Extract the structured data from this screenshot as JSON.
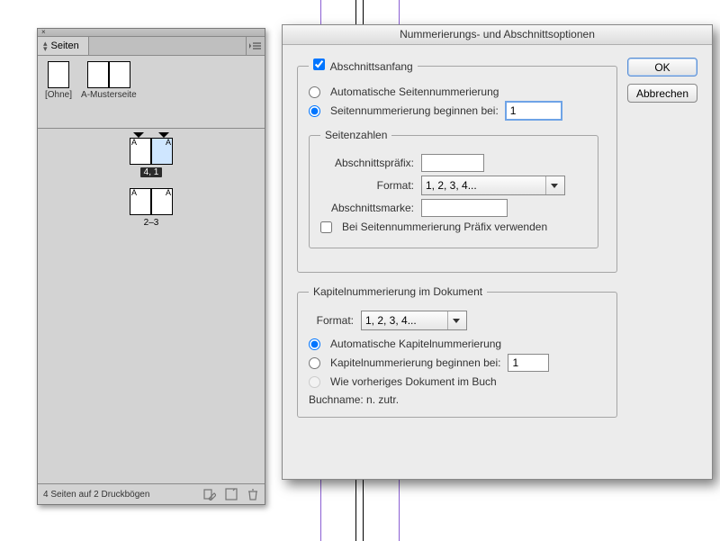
{
  "pagesPanel": {
    "tabLabel": "Seiten",
    "masters": [
      {
        "label": "[Ohne]"
      },
      {
        "label": "A-Musterseite"
      }
    ],
    "spreads": [
      {
        "label": "4, 1",
        "selected": true
      },
      {
        "label": "2–3",
        "selected": false
      }
    ],
    "footer": "4 Seiten auf 2 Druckbögen"
  },
  "dialog": {
    "title": "Nummerierungs- und Abschnittsoptionen",
    "ok": "OK",
    "cancel": "Abbrechen",
    "sectionStart": {
      "legend": "Abschnittsanfang",
      "auto": "Automatische Seitennummerierung",
      "startAt": "Seitennummerierung beginnen bei:",
      "startAtValue": "1"
    },
    "pageNumbers": {
      "legend": "Seitenzahlen",
      "prefixLabel": "Abschnittspräfix:",
      "prefixValue": "",
      "formatLabel": "Format:",
      "formatValue": "1, 2, 3, 4...",
      "markerLabel": "Abschnittsmarke:",
      "markerValue": "",
      "usePrefix": "Bei Seitennummerierung Präfix verwenden"
    },
    "chapter": {
      "legend": "Kapitelnummerierung im Dokument",
      "formatLabel": "Format:",
      "formatValue": "1, 2, 3, 4...",
      "auto": "Automatische Kapitelnummerierung",
      "startAt": "Kapitelnummerierung beginnen bei:",
      "startAtValue": "1",
      "sameAsPrev": "Wie vorheriges Dokument im Buch",
      "bookName": "Buchname: n. zutr."
    }
  }
}
